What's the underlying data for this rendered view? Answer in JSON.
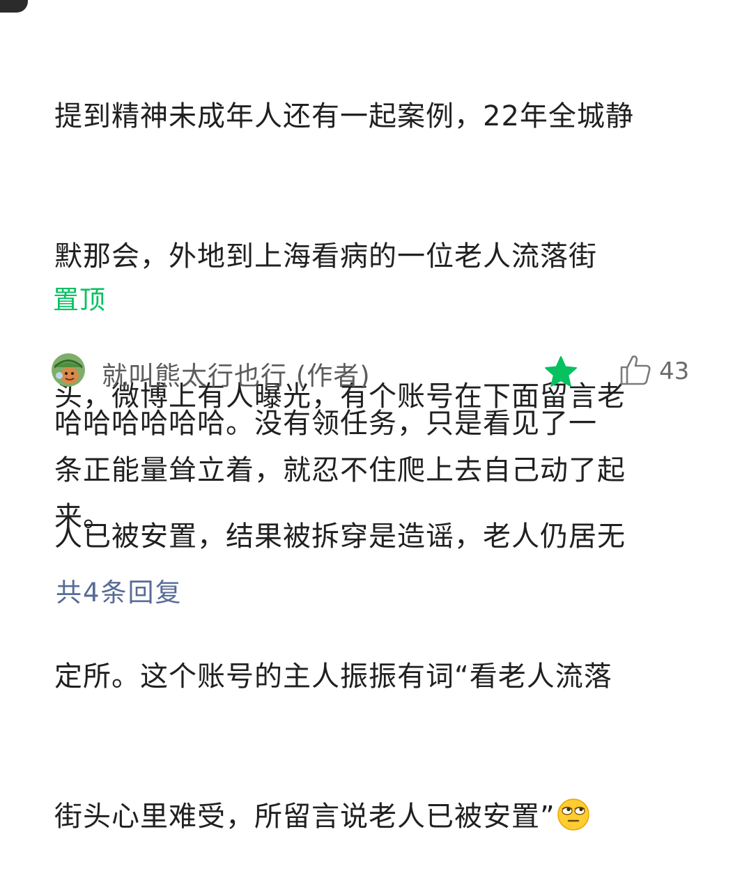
{
  "comment": {
    "lines": [
      "提到精神未成年人还有一起案例，22年全城静",
      "默那会，外地到上海看病的一位老人流落街",
      "头，微博上有人曝光，有个账号在下面留言老",
      "人已被安置，结果被拆穿是造谣，老人仍居无",
      "定所。这个账号的主人振振有词“看老人流落",
      "街头心里难受，所留言说老人已被安置”"
    ],
    "emoji": "rolling-eyes-emoji",
    "pin_label": "置顶"
  },
  "reply": {
    "author": "就叫熊太行也行 (作者)",
    "star_icon": "star-icon",
    "star_color": "#07c160",
    "like_count": "43",
    "lines": [
      "哈哈哈哈哈哈。没有领任务，只是看见了一",
      "条正能量耸立着，就忍不住爬上去自己动了起",
      "来。"
    ]
  },
  "more_replies_label": "共4条回复",
  "colors": {
    "accent_green": "#07c160",
    "link_blue": "#576b95",
    "text": "#202020",
    "muted": "#5c5c5c"
  }
}
